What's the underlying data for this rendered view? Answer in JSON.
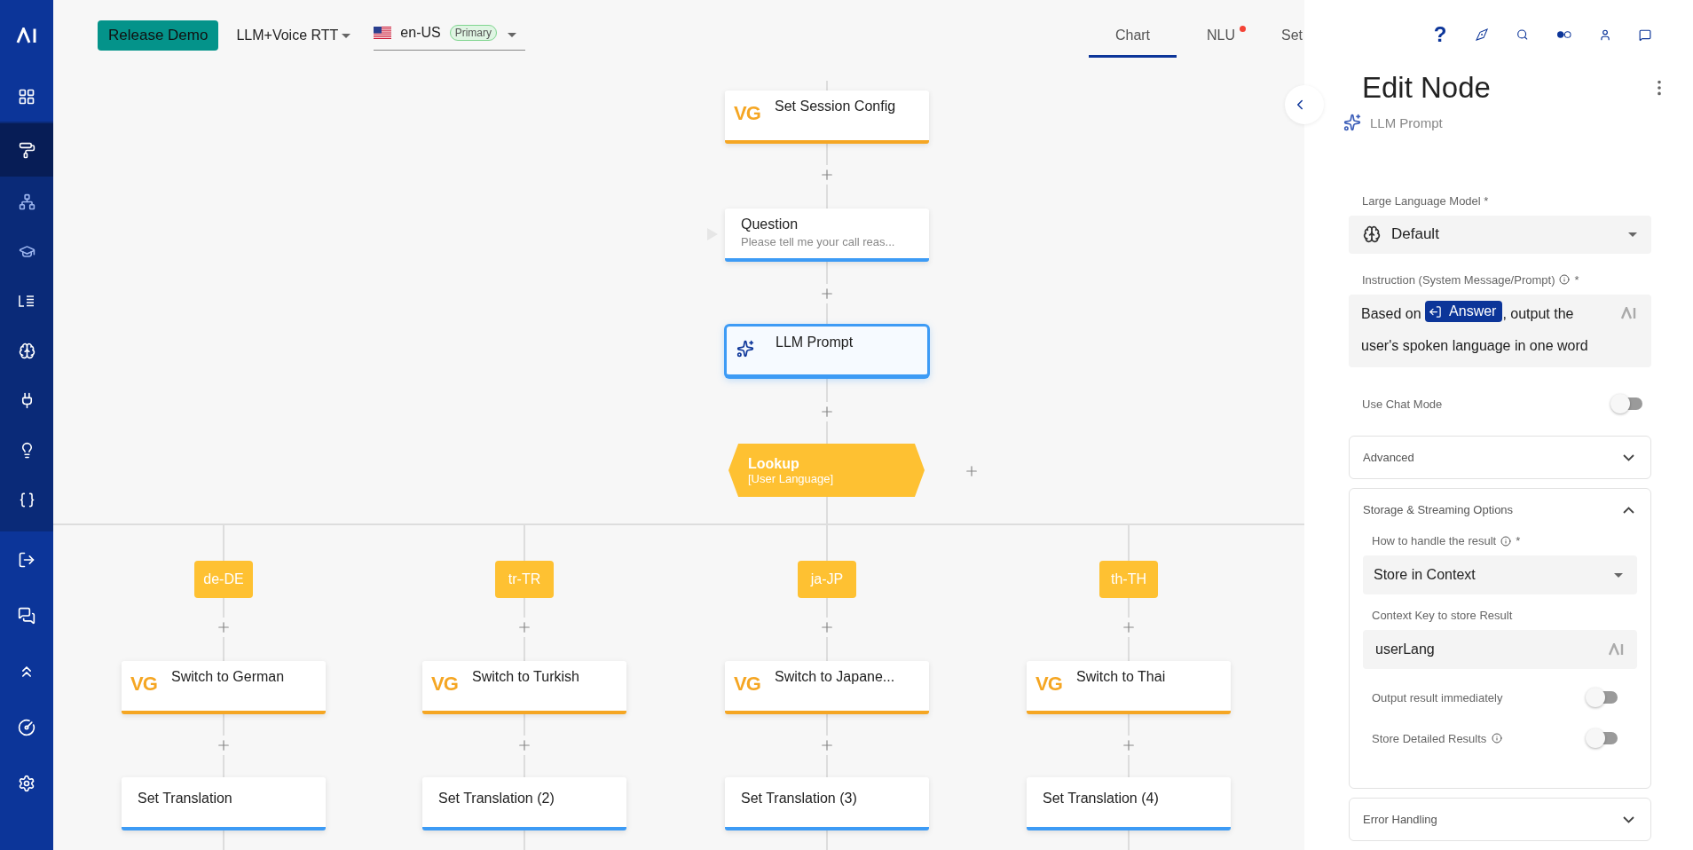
{
  "sidebar": {
    "home": {
      "selected": false
    },
    "section_items": [
      {
        "selected": true
      },
      {
        "selected": false
      },
      {
        "selected": false
      },
      {
        "selected": false
      },
      {
        "selected": false
      },
      {
        "selected": false
      },
      {
        "selected": false
      },
      {
        "selected": false
      }
    ],
    "bottom_items": [
      {
        "selected": false
      },
      {
        "selected": false
      },
      {
        "selected": false
      },
      {
        "selected": false
      },
      {
        "selected": false
      }
    ]
  },
  "top_bar": {
    "project_button": "Release Demo",
    "flow_dropdown": "LLM+Voice RTT",
    "locale": {
      "code": "en-US",
      "badge": "Primary"
    },
    "tabs": [
      {
        "label": "Chart",
        "selected": true,
        "notification": false
      },
      {
        "label": "NLU",
        "selected": false,
        "notification": true
      },
      {
        "label": "Set",
        "selected": false,
        "notification": false
      }
    ]
  },
  "canvas": {
    "main_nodes": [
      {
        "kind": "vg",
        "logo": "VG",
        "title": "Set Session Config",
        "selected": false
      },
      {
        "kind": "question",
        "title": "Question",
        "subtitle": "Please tell me your call reas...",
        "selected": false
      },
      {
        "kind": "llm",
        "title": "LLM Prompt",
        "selected": true
      }
    ],
    "lookup": {
      "title": "Lookup",
      "subtitle": "[User Language]"
    },
    "branches": [
      {
        "case": "de-DE",
        "nodes": [
          {
            "kind": "vg",
            "logo": "VG",
            "title": "Switch to German",
            "selected": false
          },
          {
            "kind": "plain",
            "title": "Set Translation",
            "selected": false
          }
        ]
      },
      {
        "case": "tr-TR",
        "nodes": [
          {
            "kind": "vg",
            "logo": "VG",
            "title": "Switch to Turkish",
            "selected": false
          },
          {
            "kind": "plain",
            "title": "Set Translation (2)",
            "selected": false
          }
        ]
      },
      {
        "case": "ja-JP",
        "nodes": [
          {
            "kind": "vg",
            "logo": "VG",
            "title": "Switch to Japane...",
            "selected": false
          },
          {
            "kind": "plain",
            "title": "Set Translation (3)",
            "selected": false
          }
        ]
      },
      {
        "case": "th-TH",
        "nodes": [
          {
            "kind": "vg",
            "logo": "VG",
            "title": "Switch to Thai",
            "selected": false
          },
          {
            "kind": "plain",
            "title": "Set Translation (4)",
            "selected": false
          }
        ]
      }
    ]
  },
  "panel": {
    "help": "?",
    "title": "Edit Node",
    "node_type": "LLM Prompt",
    "llm": {
      "label": "Large Language Model *",
      "value": "Default"
    },
    "instruction": {
      "label": "Instruction (System Message/Prompt)",
      "required": "*",
      "before": "Based on",
      "variable": "Answer",
      "after": ", output the user's spoken language in one word"
    },
    "chat_mode": {
      "label": "Use Chat Mode",
      "on": false
    },
    "sections": [
      {
        "title": "Advanced",
        "expanded": false
      },
      {
        "title": "Storage & Streaming Options",
        "expanded": true,
        "handle": {
          "label": "How to handle the result",
          "required": "*",
          "value": "Store in Context"
        },
        "key": {
          "label": "Context Key to store Result",
          "value": "userLang"
        },
        "toggles": [
          {
            "label": "Output result immediately",
            "info": false,
            "on": false
          },
          {
            "label": "Store Detailed Results",
            "info": true,
            "on": false
          }
        ]
      },
      {
        "title": "Error Handling",
        "expanded": false
      }
    ]
  }
}
